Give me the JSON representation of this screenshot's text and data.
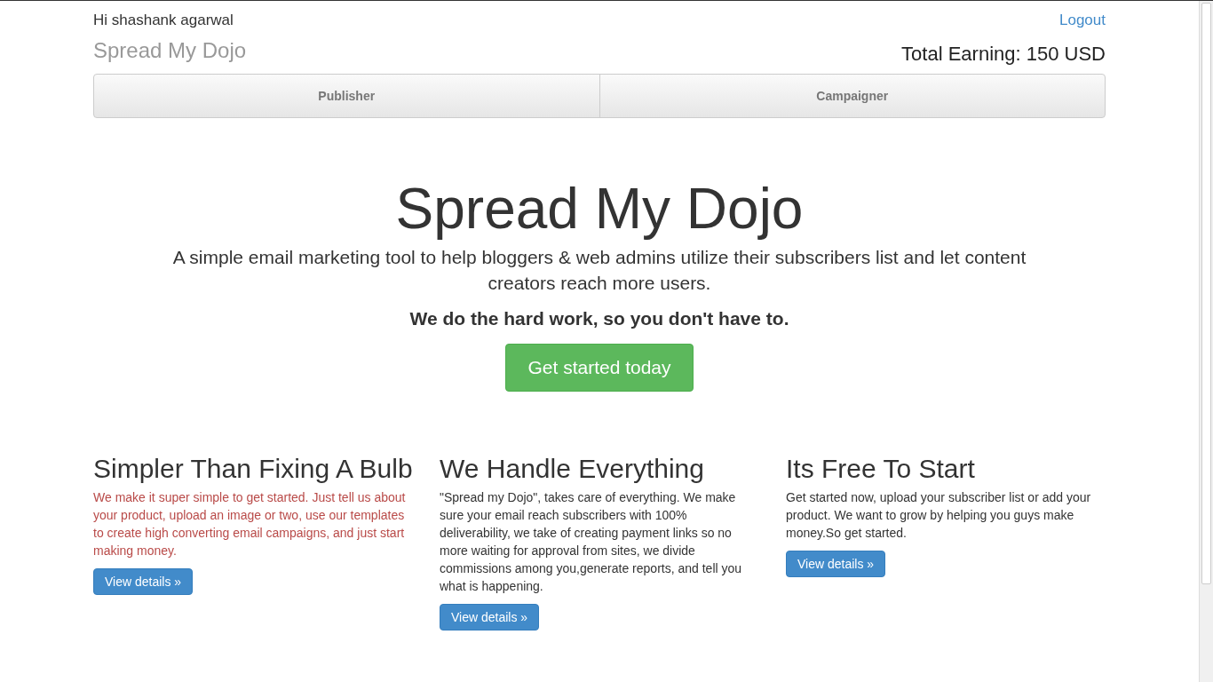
{
  "header": {
    "greeting": "Hi shashank agarwal",
    "logout": "Logout",
    "brand": "Spread My Dojo",
    "earning": "Total Earning: 150 USD"
  },
  "nav": [
    {
      "label": "Publisher"
    },
    {
      "label": "Campaigner"
    }
  ],
  "hero": {
    "title": "Spread My Dojo",
    "lead": "A simple email marketing tool to help bloggers & web admins utilize their subscribers list and let content creators reach more users.",
    "tagline": "We do the hard work, so you don't have to.",
    "button": "Get started today"
  },
  "features": [
    {
      "title": "Simpler Than Fixing A Bulb",
      "text": "We make it super simple to get started. Just tell us about your product, upload an image or two, use our templates to create high converting email campaigns, and just start making money.",
      "highlighted": true,
      "button": "View details »"
    },
    {
      "title": "We Handle Everything",
      "text": "\"Spread my Dojo\", takes care of everything. We make sure your email reach subscribers with 100% deliverability, we take of creating payment links so no more waiting for approval from sites, we divide commissions among you,generate reports, and tell you what is happening.",
      "highlighted": false,
      "button": "View details »"
    },
    {
      "title": "Its Free To Start",
      "text": "Get started now, upload your subscriber list or add your product. We want to grow by helping you guys make money.So get started.",
      "highlighted": false,
      "button": "View details »"
    }
  ]
}
